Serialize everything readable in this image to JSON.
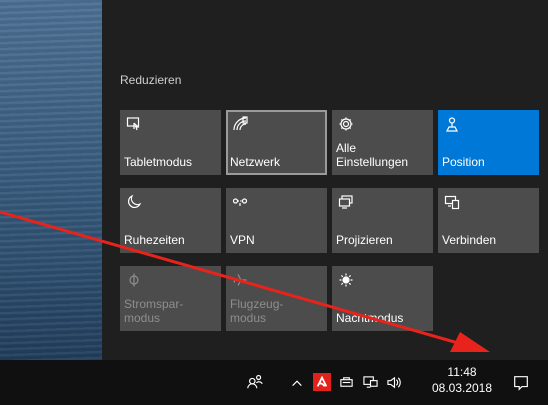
{
  "action_center": {
    "collapse_label": "Reduzieren",
    "tiles": [
      {
        "label": "Tabletmodus",
        "icon": "tablet-mode-icon"
      },
      {
        "label": "Netzwerk",
        "icon": "network-icon"
      },
      {
        "label": "Alle\nEinstellungen",
        "icon": "settings-gear-icon"
      },
      {
        "label": "Position",
        "icon": "location-icon"
      },
      {
        "label": "Ruhezeiten",
        "icon": "moon-icon"
      },
      {
        "label": "VPN",
        "icon": "vpn-icon"
      },
      {
        "label": "Projizieren",
        "icon": "project-icon"
      },
      {
        "label": "Verbinden",
        "icon": "connect-icon"
      },
      {
        "label": "Stromspar-\nmodus",
        "icon": "battery-saver-icon"
      },
      {
        "label": "Flugzeug-\nmodus",
        "icon": "airplane-icon"
      },
      {
        "label": "Nachtmodus",
        "icon": "night-light-icon"
      }
    ]
  },
  "taskbar": {
    "time": "11:48",
    "date": "08.03.2018"
  },
  "colors": {
    "accent": "#0078d7",
    "arrow": "#e8231b"
  }
}
